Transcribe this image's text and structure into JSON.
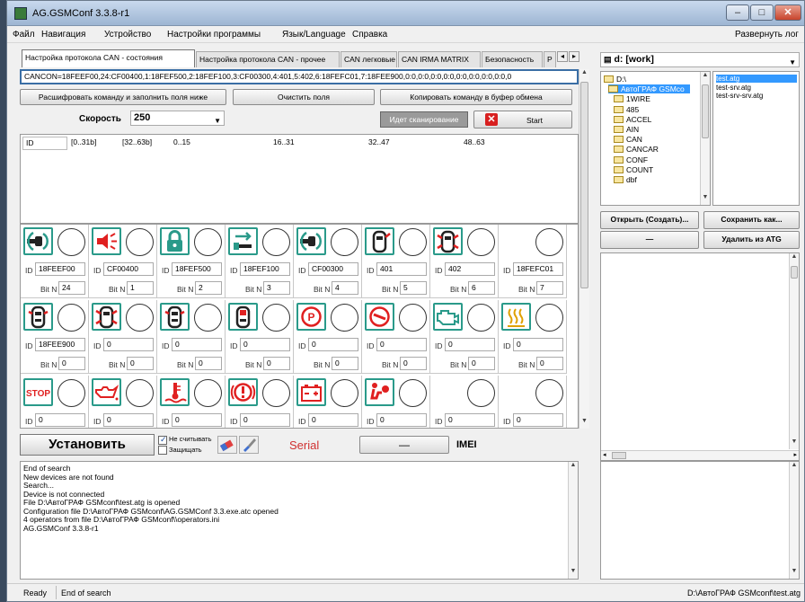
{
  "window": {
    "title": "AG.GSMConf 3.3.8-r1"
  },
  "menu": [
    "Файл",
    "Навигация",
    "Устройство",
    "Настройки программы",
    "Язык/Language",
    "Справка"
  ],
  "menu_right": "Развернуть лог",
  "tabs": [
    "Настройка протокола CAN - состояния",
    "Настройка протокола CAN - прочее",
    "CAN легковые",
    "CAN IRMA MATRIX",
    "Безопасность",
    "P"
  ],
  "command": "CANCON=18FEEF00,24:CF00400,1:18FEF500,2:18FEF100,3:CF00300,4:401,5:402,6:18FEFC01,7:18FEE900,0:0,0:0,0:0,0:0,0:0,0:0,0:0,0:0,0",
  "buttons": {
    "decode": "Расшифровать команду и заполнить поля ниже",
    "clear": "Очистить поля",
    "copy": "Копировать команду в буфер обмена",
    "start": "Start",
    "install": "Установить",
    "open": "Открыть (Создать)...",
    "save_as": "Сохранить как...",
    "dash": "—",
    "delete": "Удалить из ATG"
  },
  "speed": {
    "label": "Скорость",
    "value": "250"
  },
  "scan_status": "Идет сканирование",
  "grid_headers": [
    "ID",
    "[0..31b]",
    "[32..63b]",
    "0..15",
    "16..31",
    "32..47",
    "48..63"
  ],
  "labels": {
    "id": "ID",
    "bit": "Bit N"
  },
  "cells": [
    {
      "icon": "plug-icon",
      "id": "18FEEF00",
      "bit": "24"
    },
    {
      "icon": "horn-icon",
      "id": "CF00400",
      "bit": "1"
    },
    {
      "icon": "lock-icon",
      "id": "18FEF500",
      "bit": "2"
    },
    {
      "icon": "key-icon",
      "id": "18FEF100",
      "bit": "3"
    },
    {
      "icon": "plug-icon",
      "id": "CF00300",
      "bit": "4"
    },
    {
      "icon": "car-door-icon",
      "id": "401",
      "bit": "5"
    },
    {
      "icon": "car-door-open-icon",
      "id": "402",
      "bit": "6"
    },
    {
      "icon": "",
      "id": "18FEFC01",
      "bit": "7"
    },
    {
      "icon": "car-top-icon",
      "id": "18FEE900",
      "bit": "0"
    },
    {
      "icon": "car-door-open-icon",
      "id": "0",
      "bit": "0"
    },
    {
      "icon": "car-top-icon",
      "id": "0",
      "bit": "0"
    },
    {
      "icon": "car-trunk-icon",
      "id": "0",
      "bit": "0"
    },
    {
      "icon": "parking-brake-icon",
      "id": "0",
      "bit": "0"
    },
    {
      "icon": "brake-pad-icon",
      "id": "0",
      "bit": "0"
    },
    {
      "icon": "engine-icon",
      "id": "0",
      "bit": "0"
    },
    {
      "icon": "heater-icon",
      "id": "0",
      "bit": "0"
    },
    {
      "icon": "stop-icon",
      "id": "0",
      "bit": ""
    },
    {
      "icon": "oil-can-icon",
      "id": "0",
      "bit": ""
    },
    {
      "icon": "coolant-temp-icon",
      "id": "0",
      "bit": ""
    },
    {
      "icon": "warning-icon",
      "id": "0",
      "bit": ""
    },
    {
      "icon": "battery-icon",
      "id": "0",
      "bit": ""
    },
    {
      "icon": "airbag-icon",
      "id": "0",
      "bit": ""
    },
    {
      "icon": "",
      "id": "0",
      "bit": ""
    },
    {
      "icon": "",
      "id": "0",
      "bit": ""
    }
  ],
  "checkboxes": {
    "no_read": "Не считывать",
    "protect": "Защищать"
  },
  "serial": "Serial",
  "imei_dash": "—",
  "imei": "IMEI",
  "log": [
    "End of search",
    "New devices are not found",
    "Search...",
    "Device is not connected",
    "File D:\\АвтоГРАФ GSMconf\\test.atg is opened",
    "Configuration file D:\\АвтоГРАФ GSMconf\\AG.GSMConf 3.3.exe.atc opened",
    "4 operators from file D:\\АвтоГРАФ GSMconf\\\\operators.ini",
    "AG.GSMConf 3.3.8-r1"
  ],
  "drive": "d: [work]",
  "tree": [
    "D:\\",
    "АвтоГРАФ GSMco",
    "1WIRE",
    "485",
    "ACCEL",
    "AIN",
    "CAN",
    "CANCAR",
    "CONF",
    "COUNT",
    "dbf"
  ],
  "files": [
    "test.atg",
    "test-srv.atg",
    "test-srv-srv.atg"
  ],
  "status": {
    "left1": "Ready",
    "left2": "End of search",
    "right": "D:\\АвтоГРАФ GSMconf\\test.atg"
  },
  "colors": {
    "accent": "#2a9a8a",
    "red": "#e02020",
    "select": "#3399ff",
    "serial": "#d03030"
  }
}
